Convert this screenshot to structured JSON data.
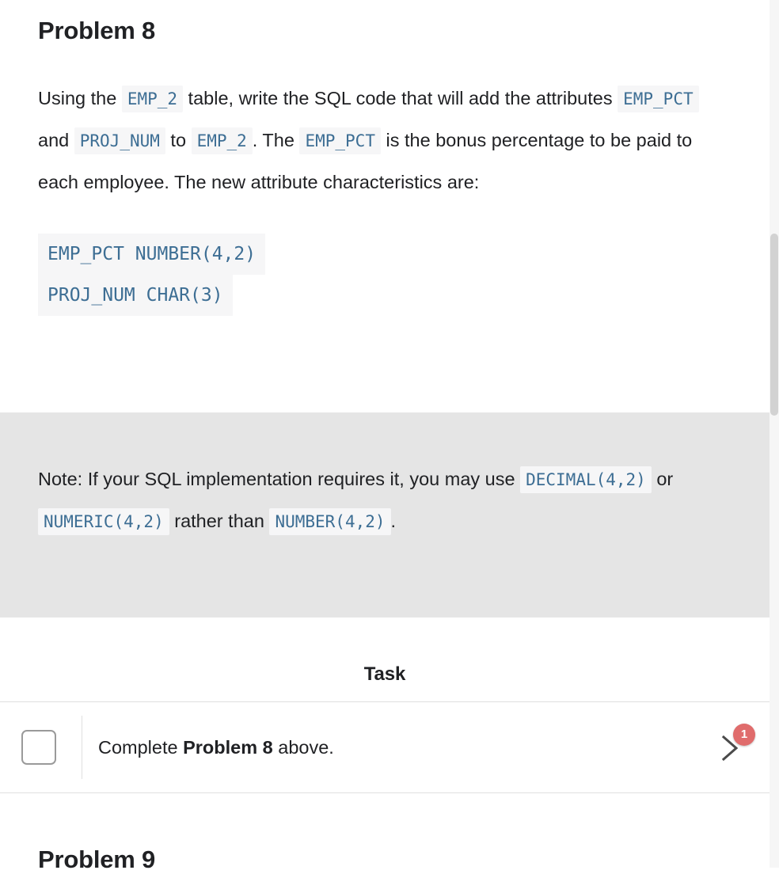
{
  "problem": {
    "title": "Problem 8",
    "paragraph_parts": [
      {
        "type": "text",
        "value": "Using the "
      },
      {
        "type": "code",
        "value": "EMP_2"
      },
      {
        "type": "text",
        "value": " table, write the SQL code that will add the attributes "
      },
      {
        "type": "code",
        "value": "EMP_PCT"
      },
      {
        "type": "text",
        "value": " and "
      },
      {
        "type": "code",
        "value": "PROJ_NUM"
      },
      {
        "type": "text",
        "value": " to "
      },
      {
        "type": "code",
        "value": "EMP_2"
      },
      {
        "type": "text",
        "value": ". The "
      },
      {
        "type": "code",
        "value": "EMP_PCT"
      },
      {
        "type": "text",
        "value": " is the bonus percentage to be paid to each employee. The new attribute characteristics are:"
      }
    ],
    "p_seg_1": "Using the ",
    "p_code_1": "EMP_2",
    "p_seg_2": " table, write the SQL code that will add the attributes ",
    "p_code_2": "EMP_PCT",
    "p_seg_3": " and ",
    "p_code_3": "PROJ_NUM",
    "p_seg_4": " to ",
    "p_code_4": "EMP_2",
    "p_seg_5": ". The ",
    "p_code_5": "EMP_PCT",
    "p_seg_6": " is the bonus percentage to be paid to each employee. The new attribute characteristics are:",
    "code_lines": [
      "EMP_PCT NUMBER(4,2)",
      "PROJ_NUM CHAR(3)"
    ],
    "code_line_1": "EMP_PCT NUMBER(4,2)",
    "code_line_2": "PROJ_NUM CHAR(3)"
  },
  "note": {
    "n_seg_1": "Note: If your SQL implementation requires it, you may use ",
    "n_code_1": "DECIMAL(4,2)",
    "n_seg_2": " or ",
    "n_code_2": "NUMERIC(4,2)",
    "n_seg_3": " rather than ",
    "n_code_3": "NUMBER(4,2)",
    "n_seg_4": "."
  },
  "task": {
    "heading": "Task",
    "checkbox_checked": false,
    "label_prefix": "Complete ",
    "label_bold": "Problem 8",
    "label_suffix": " above.",
    "badge_count": "1",
    "chevron_icon": "chevron-right-icon"
  },
  "next_problem": {
    "title": "Problem 9"
  },
  "colors": {
    "code_text": "#3d6e94",
    "code_chip_bg": "#f6f6f7",
    "note_band_bg": "#e5e5e5",
    "badge_bg": "#e06c6c",
    "body_text": "#202124",
    "rule": "#e0e0e0",
    "checkbox_border": "#9a9a9a",
    "scrollbar_thumb": "#d2d2d2"
  }
}
